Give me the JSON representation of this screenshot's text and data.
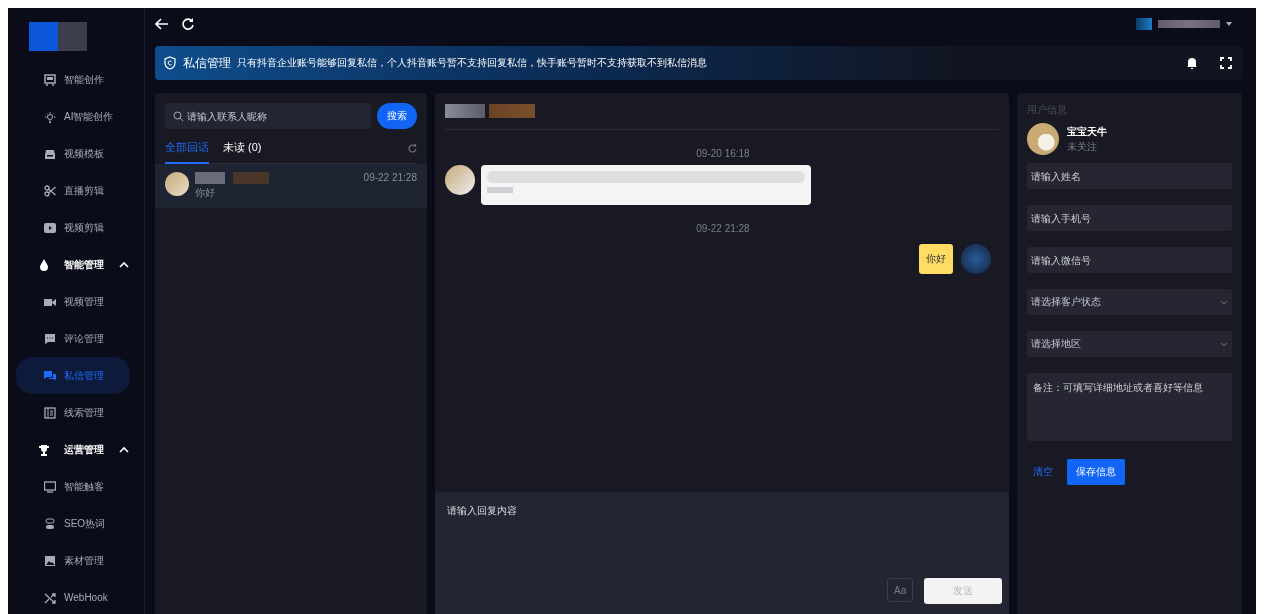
{
  "sidebar": {
    "items": [
      {
        "kind": "item",
        "label": "智能创作",
        "selected": false
      },
      {
        "kind": "item",
        "label": "AI智能创作",
        "selected": false
      },
      {
        "kind": "item",
        "label": "视频模板",
        "selected": false
      },
      {
        "kind": "item",
        "label": "直播剪辑",
        "selected": false
      },
      {
        "kind": "item",
        "label": "视频剪辑",
        "selected": false
      },
      {
        "kind": "group",
        "label": "智能管理",
        "selected": false,
        "expanded": true,
        "children": [
          {
            "kind": "item",
            "label": "视频管理",
            "selected": false
          },
          {
            "kind": "item",
            "label": "评论管理",
            "selected": false
          },
          {
            "kind": "item",
            "label": "私信管理",
            "selected": true
          },
          {
            "kind": "item",
            "label": "线索管理",
            "selected": false
          }
        ]
      },
      {
        "kind": "group",
        "label": "运营管理",
        "selected": false,
        "expanded": true,
        "children": [
          {
            "kind": "item",
            "label": "智能触客",
            "selected": false
          },
          {
            "kind": "item",
            "label": "SEO热词",
            "selected": false
          },
          {
            "kind": "item",
            "label": "素材管理",
            "selected": false
          },
          {
            "kind": "item",
            "label": "WebHook",
            "selected": false
          }
        ]
      }
    ]
  },
  "banner": {
    "title": "私信管理",
    "message": "只有抖音企业账号能够回复私信，个人抖音账号暂不支持回复私信，快手账号暂时不支持获取不到私信消息"
  },
  "contacts": {
    "search": {
      "placeholder": "请输入联系人昵称",
      "button": "搜索"
    },
    "tabs": [
      {
        "label": "全部回话",
        "selected": true
      },
      {
        "label": "未读 (0)",
        "selected": false
      }
    ],
    "list": [
      {
        "time": "09-22 21:28",
        "preview": "你好",
        "selected": true
      }
    ]
  },
  "chat": {
    "messages": [
      {
        "kind": "time",
        "text": "09-20 16:18"
      },
      {
        "kind": "incoming"
      },
      {
        "kind": "time",
        "text": "09-22 21:28"
      },
      {
        "kind": "outgoing",
        "text": "你好"
      }
    ],
    "reply": {
      "placeholder": "请输入回复内容",
      "format_button": "Aa",
      "send_button": "发送",
      "send_disabled": true
    }
  },
  "user_info": {
    "title": "用户信息",
    "name": "宝宝天牛",
    "status": "未关注",
    "fields": [
      {
        "kind": "input",
        "placeholder": "请输入姓名"
      },
      {
        "kind": "input",
        "placeholder": "请输入手机号"
      },
      {
        "kind": "input",
        "placeholder": "请输入微信号"
      },
      {
        "kind": "select",
        "placeholder": "请选择客户状态"
      },
      {
        "kind": "select",
        "placeholder": "请选择地区"
      },
      {
        "kind": "textarea",
        "placeholder": "备注：可填写详细地址或者喜好等信息"
      }
    ],
    "clear_button": "清空",
    "save_button": "保存信息"
  }
}
